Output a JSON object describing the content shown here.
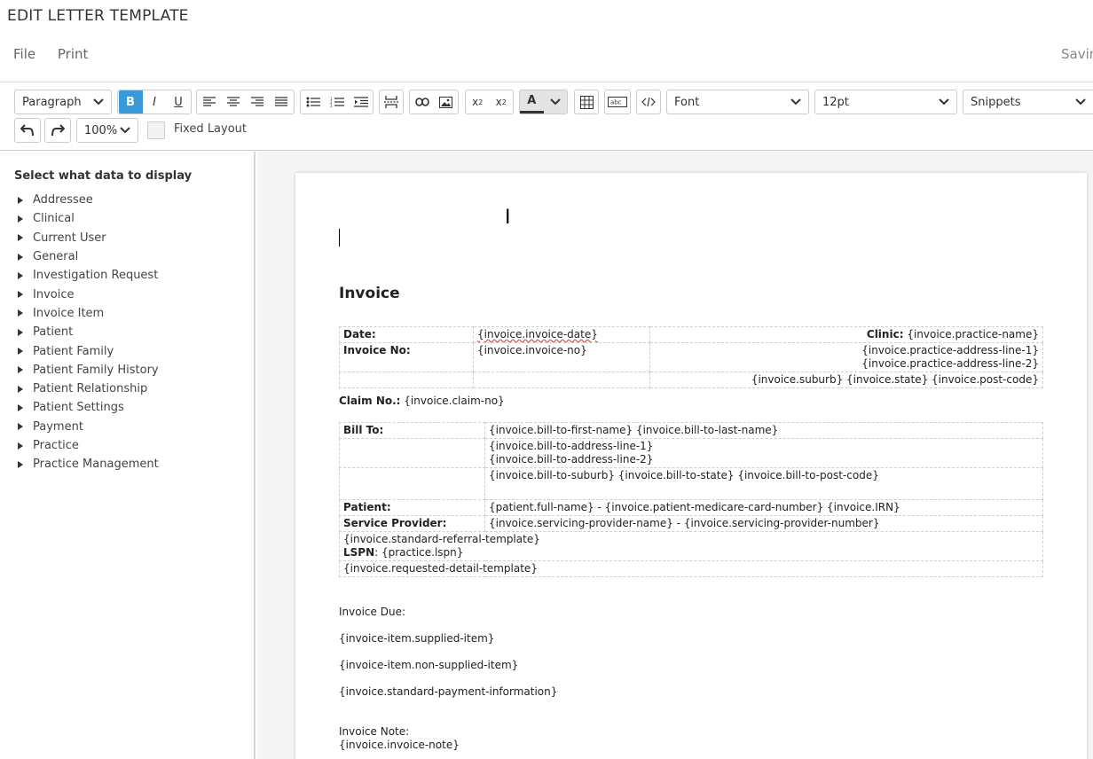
{
  "page_title": "EDIT LETTER TEMPLATE",
  "menu": {
    "file": "File",
    "print": "Print",
    "status": "Saving"
  },
  "toolbar": {
    "block_format": "Paragraph",
    "bold": "B",
    "italic": "I",
    "underline": "U",
    "text_color": "A",
    "zoom": "100%",
    "font": "Font",
    "font_size": "12pt",
    "snippets": "Snippets",
    "fixed_layout": "Fixed Layout",
    "fixed_layout_checked": false
  },
  "sidebar": {
    "title": "Select what data to display",
    "items": [
      "Addressee",
      "Clinical",
      "Current User",
      "General",
      "Investigation Request",
      "Invoice",
      "Invoice Item",
      "Patient",
      "Patient Family",
      "Patient Family History",
      "Patient Relationship",
      "Patient Settings",
      "Payment",
      "Practice",
      "Practice Management"
    ]
  },
  "document": {
    "heading": "Invoice",
    "header_table": {
      "date_label": "Date:",
      "date_value": "{invoice.invoice-date}",
      "clinic_label": "Clinic:",
      "clinic_value": "{invoice.practice-name}",
      "invoice_no_label": "Invoice No:",
      "invoice_no_value": "{invoice.invoice-no}",
      "address_line_1": "{invoice.practice-address-line-1}",
      "address_line_2": "{invoice.practice-address-line-2}",
      "suburb_state_post": "{invoice.suburb} {invoice.state} {invoice.post-code}"
    },
    "claim_label": "Claim No.:",
    "claim_value": "{invoice.claim-no}",
    "bill_table": {
      "bill_to_label": "Bill To:",
      "bill_to_name": "{invoice.bill-to-first-name} {invoice.bill-to-last-name}",
      "bill_to_address_1": "{invoice.bill-to-address-line-1}",
      "bill_to_address_2": "{invoice.bill-to-address-line-2}",
      "bill_to_suburb": "{invoice.bill-to-suburb} {invoice.bill-to-state} {invoice.bill-to-post-code}",
      "patient_label": "Patient:",
      "patient_value": "{patient.full-name} - {invoice.patient-medicare-card-number} {invoice.IRN}",
      "provider_label": "Service Provider:",
      "provider_value": "{invoice.servicing-provider-name} - {invoice.servicing-provider-number}",
      "referral_template": "{invoice.standard-referral-template}",
      "lspn_label": "LSPN",
      "lspn_value": "{practice.lspn}",
      "requested_detail": "{invoice.requested-detail-template}"
    },
    "invoice_due": "Invoice Due:",
    "supplied_item": "{invoice-item.supplied-item}",
    "non_supplied_item": "{invoice-item.non-supplied-item}",
    "payment_info": "{invoice.standard-payment-information}",
    "invoice_note_label": "Invoice Note:",
    "invoice_note_value": "{invoice.invoice-note}"
  }
}
